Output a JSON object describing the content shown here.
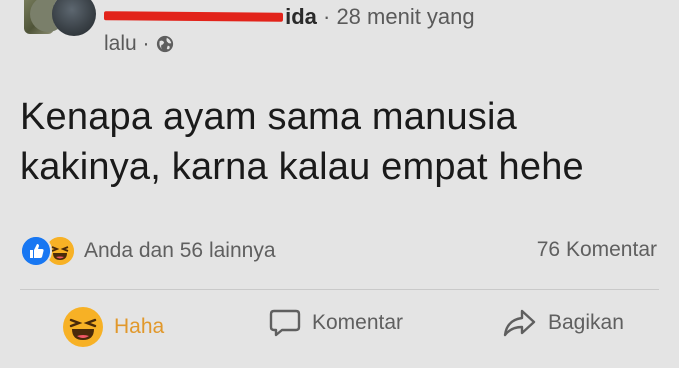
{
  "post": {
    "author_visible_suffix": "ida",
    "time_line1": "· 28 menit yang",
    "time_line2": "lalu ·",
    "text_line1": "Kenapa ayam sama manusia",
    "text_line2": "kakinya, karna kalau empat hehe",
    "privacy_icon": "globe-icon"
  },
  "stats": {
    "reactions_text": "Anda dan 56 lainnya",
    "comments_text": "76 Komentar",
    "reaction_icons": [
      "like-icon",
      "haha-icon"
    ]
  },
  "actions": {
    "haha_label": "Haha",
    "comment_label": "Komentar",
    "share_label": "Bagikan"
  },
  "colors": {
    "background": "#e4e4e4",
    "haha_active": "#e1982b",
    "like_blue": "#1877f2",
    "redaction_red": "#e2231a"
  }
}
